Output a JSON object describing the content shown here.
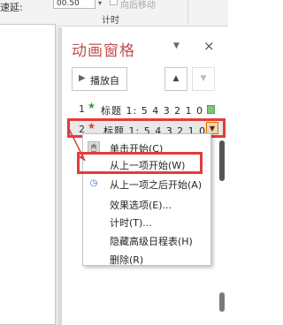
{
  "ribbon": {
    "speed_label": "速延:",
    "duration_value": "00.50",
    "spin_icon": "chevron-down-icon",
    "move_label": "向后移动",
    "group_label": "计时"
  },
  "pane": {
    "title": "动画窗格",
    "dropdown_glyph": "▼",
    "close_glyph": "×",
    "play_button_label": "播放自",
    "play_glyph": "▶",
    "up_glyph": "▲",
    "down_glyph": "▼"
  },
  "animations": [
    {
      "number": "1",
      "star_glyph": "★",
      "label": "标题 1: 5 4 3 2 1 0"
    },
    {
      "number": "2",
      "star_glyph": "★",
      "label": "标题 1: 5 4 3 2 1 0",
      "dropdown_glyph": "▼"
    }
  ],
  "context_menu": {
    "items": [
      {
        "icon": "mouse-click-icon",
        "glyph": "🖱",
        "label": "单击开始(C)"
      },
      {
        "icon": "",
        "glyph": "",
        "label": "从上一项开始(W)"
      },
      {
        "icon": "clock-icon",
        "glyph": "◷",
        "label": "从上一项之后开始(A)"
      },
      {
        "icon": "",
        "glyph": "",
        "label": "效果选项(E)..."
      },
      {
        "icon": "",
        "glyph": "",
        "label": "计时(T)..."
      },
      {
        "icon": "",
        "glyph": "",
        "label": "隐藏高级日程表(H)"
      },
      {
        "icon": "",
        "glyph": "",
        "label": "删除(R)"
      }
    ]
  },
  "colors": {
    "title_red": "#c0504d",
    "highlight_red": "#e33b3b",
    "timeline_green": "#7cc576",
    "dropdown_orange": "#f7d3b0"
  }
}
